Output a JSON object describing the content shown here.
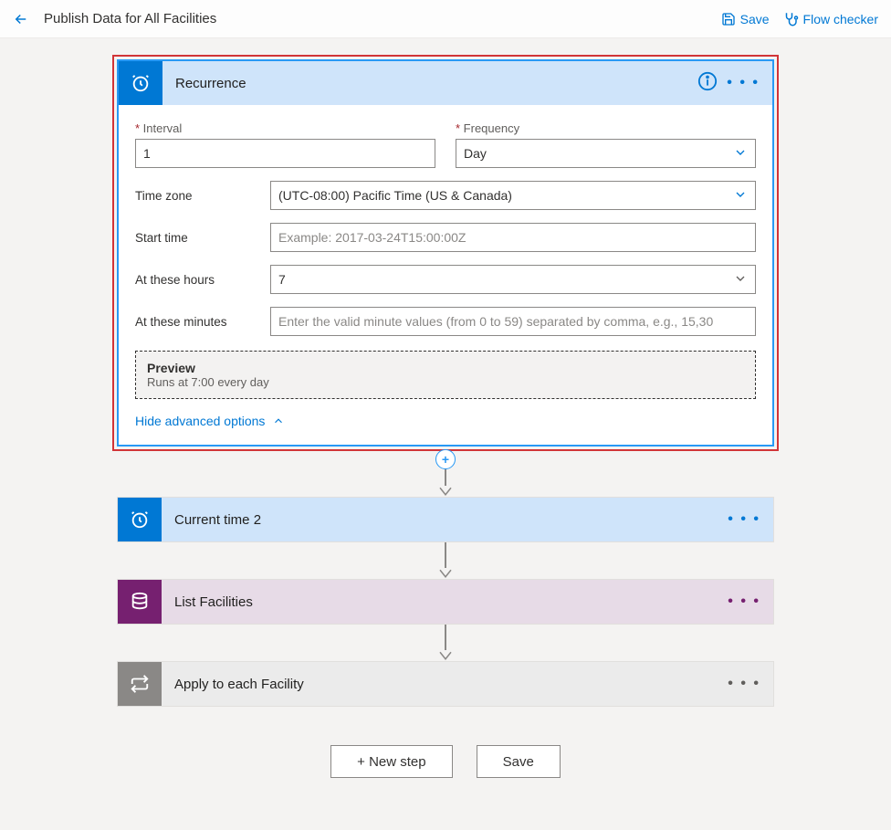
{
  "topbar": {
    "title": "Publish Data for All Facilities",
    "save_label": "Save",
    "flow_checker_label": "Flow checker"
  },
  "recurrence": {
    "title": "Recurrence",
    "interval_label": "Interval",
    "interval_value": "1",
    "frequency_label": "Frequency",
    "frequency_value": "Day",
    "timezone_label": "Time zone",
    "timezone_value": "(UTC-08:00) Pacific Time (US & Canada)",
    "starttime_label": "Start time",
    "starttime_placeholder": "Example: 2017-03-24T15:00:00Z",
    "hours_label": "At these hours",
    "hours_value": "7",
    "minutes_label": "At these minutes",
    "minutes_placeholder": "Enter the valid minute values (from 0 to 59) separated by comma, e.g., 15,30",
    "preview_title": "Preview",
    "preview_desc": "Runs at 7:00 every day",
    "advanced_toggle": "Hide advanced options"
  },
  "steps": {
    "current_time": "Current time 2",
    "list_facilities": "List Facilities",
    "apply_each": "Apply to each Facility"
  },
  "footer": {
    "new_step": "+ New step",
    "save": "Save"
  },
  "glyphs": {
    "dots": "• • •",
    "plus": "+"
  }
}
